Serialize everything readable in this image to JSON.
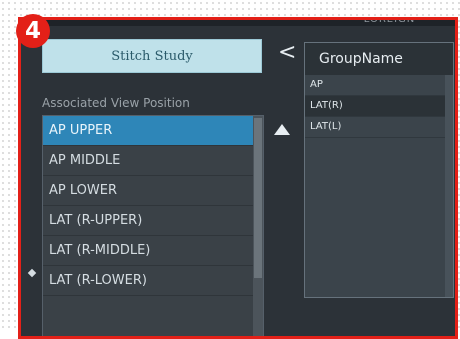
{
  "badge": "4",
  "top_right_text": "LOREIGN",
  "stitch_button": "Stitch Study",
  "collapse_arrow": "<",
  "associated_label": "Associated View Position",
  "view_positions": [
    "AP UPPER",
    "AP MIDDLE",
    "AP LOWER",
    "LAT (R-UPPER)",
    "LAT (R-MIDDLE)",
    "LAT (R-LOWER)"
  ],
  "selected_index": 0,
  "group_panel": {
    "header": "GroupName",
    "items": [
      "AP",
      "LAT(R)",
      "LAT(L)"
    ]
  },
  "colors": {
    "highlight_frame": "#e32018",
    "selected_row": "#2e86b8",
    "stitch_button": "#bfe1ea",
    "panel_bg": "#2c3238"
  },
  "icons": {
    "collapse": "chevron-left-icon",
    "move_up": "triangle-up-icon"
  }
}
